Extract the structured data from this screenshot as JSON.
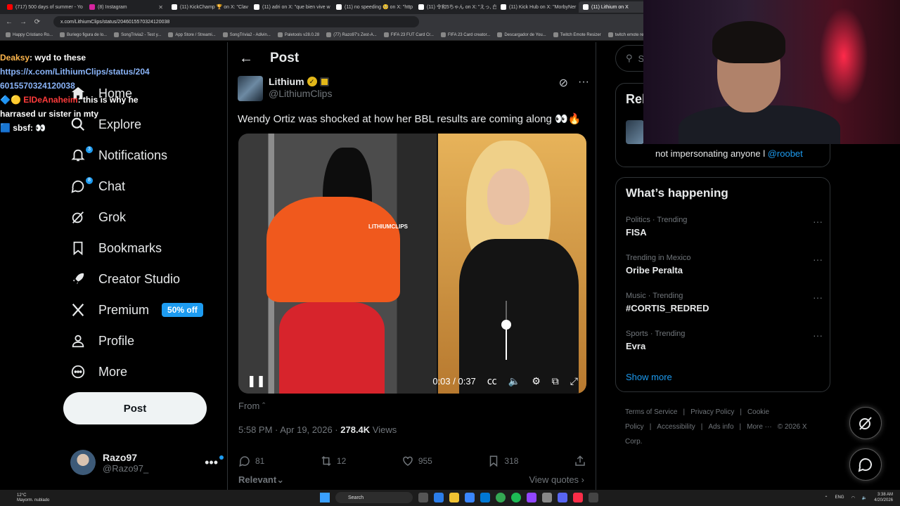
{
  "browser": {
    "tabs": [
      {
        "title": "(717) 500 days of summer - Yo",
        "color": "#ff0000"
      },
      {
        "title": "(8) Instagram",
        "color": "#d6249f"
      },
      {
        "title": "(11) KickChamp 🏆 on X: \"Clav",
        "color": "#ffffff"
      },
      {
        "title": "(11) adri on X: \"que bien vive w",
        "color": "#ffffff"
      },
      {
        "title": "(11) no speeding 🥺 on X: \"http",
        "color": "#ffffff"
      },
      {
        "title": "(11) 令和5ちゃん on X: \"えっ, 白",
        "color": "#ffffff"
      },
      {
        "title": "(11) Kick Hub on X: \"MorbyNer",
        "color": "#ffffff"
      },
      {
        "title": "(11) Lithium on X",
        "color": "#ffffff"
      }
    ],
    "url": "x.com/LithiumClips/status/2046015570324120038",
    "bookmarks": [
      "Happy Cristiano Ro...",
      "Buriego figura de lo...",
      "SongTrivia2 - Test y...",
      "App Store / Streami...",
      "SongTrivia2 - Adivin...",
      "Paletools v28.0.28",
      "(77) Razo97's Zest-A...",
      "FIFA 23 FUT Card Cr...",
      "FIFA 23 Card creator...",
      "Descargador de You...",
      "Twitch Emote Resizer",
      "twitch emote re"
    ]
  },
  "chat": {
    "line1_user": "Deaksy",
    "line1_msg": ": wyd to these",
    "line2_link": "https://x.com/LithiumClips/status/2046015570324120038",
    "line3_user": "ElDeAnaheim",
    "line3_msg": ": this is why he harrased ur sister in mty",
    "line4_user": "sbsf",
    "line4_msg": ": 👀"
  },
  "nav": {
    "items": [
      {
        "label": "Home",
        "icon": "home-icon"
      },
      {
        "label": "Explore",
        "icon": "search-icon"
      },
      {
        "label": "Notifications",
        "icon": "bell-icon",
        "badge": "3"
      },
      {
        "label": "Chat",
        "icon": "chat-icon",
        "badge": "8"
      },
      {
        "label": "Grok",
        "icon": "grok-icon"
      },
      {
        "label": "Bookmarks",
        "icon": "bookmark-icon"
      },
      {
        "label": "Creator Studio",
        "icon": "rocket-icon"
      },
      {
        "label": "Premium",
        "icon": "x-logo-icon",
        "promo": "50% off"
      },
      {
        "label": "Profile",
        "icon": "person-icon"
      },
      {
        "label": "More",
        "icon": "more-circle-icon"
      }
    ],
    "post_button": "Post",
    "account": {
      "name": "Razo97",
      "handle": "@Razo97_"
    }
  },
  "post": {
    "header_title": "Post",
    "author_name": "Lithium",
    "author_handle": "@LithiumClips",
    "text": "Wendy Ortiz was shocked at how her BBL results are coming along 👀🔥",
    "watermark": "LITHIUMCLIPS",
    "video": {
      "time": "0:03 / 0:37",
      "volume_level": 0.6
    },
    "from": "From ˆ",
    "time": "5:58 PM · Apr 19, 2026 · ",
    "views_count": "278.4K",
    "views_label": " Views",
    "replies": "81",
    "reposts": "12",
    "likes": "955",
    "bookmarks": "318",
    "relevant": "Relevant",
    "view_quotes": "View quotes ›"
  },
  "right": {
    "search_placeholder": "Se",
    "relevant_title": "Rel",
    "relevant_bio": "not impersonating anyone l ",
    "relevant_mention": "@roobet",
    "happening_title": "What’s happening",
    "trends": [
      {
        "context": "Politics · Trending",
        "name": "FISA"
      },
      {
        "context": "Trending in Mexico",
        "name": "Oribe Peralta"
      },
      {
        "context": "Music · Trending",
        "name": "#CORTIS_REDRED"
      },
      {
        "context": "Sports · Trending",
        "name": "Evra"
      }
    ],
    "show_more": "Show more",
    "footer": [
      "Terms of Service",
      "|",
      "Privacy Policy",
      "|",
      "Cookie Policy",
      "|",
      "Accessibility",
      "|",
      "Ads info",
      "|",
      "More ···",
      "© 2026 X Corp."
    ]
  },
  "taskbar": {
    "weather_temp": "12°C",
    "weather_desc": "Mayorm. nublado",
    "search_label": "Search",
    "lang": "ENG",
    "time": "3:38 AM",
    "date": "4/20/2026"
  },
  "colors": {
    "accent": "#1d9bf0",
    "background": "#000000",
    "border": "#2f3336"
  }
}
